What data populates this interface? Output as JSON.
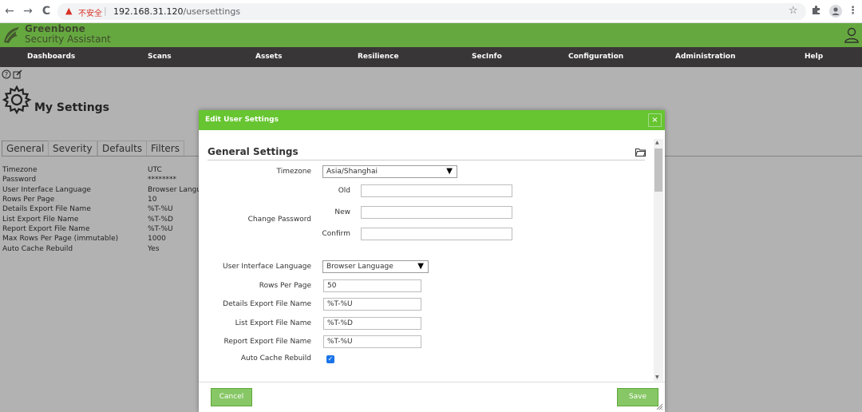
{
  "browser": {
    "back": "←",
    "forward": "→",
    "reload": "C",
    "insecure_label": "不安全",
    "url_host": "192.168.31.120",
    "url_path": "/usersettings"
  },
  "app": {
    "brand_line1": "Greenbone",
    "brand_line2": "Security Assistant"
  },
  "menu": {
    "items": [
      "Dashboards",
      "Scans",
      "Assets",
      "Resilience",
      "SecInfo",
      "Configuration",
      "Administration",
      "Help"
    ]
  },
  "page": {
    "title": "My Settings",
    "tabs": [
      "General",
      "Severity",
      "Defaults",
      "Filters"
    ],
    "settings": [
      {
        "label": "Timezone",
        "value": "UTC"
      },
      {
        "label": "Password",
        "value": "********"
      },
      {
        "label": "User Interface Language",
        "value": "Browser Langu"
      },
      {
        "label": "Rows Per Page",
        "value": "10"
      },
      {
        "label": "Details Export File Name",
        "value": "%T-%U"
      },
      {
        "label": "List Export File Name",
        "value": "%T-%D"
      },
      {
        "label": "Report Export File Name",
        "value": "%T-%U"
      },
      {
        "label": "Max Rows Per Page (immutable)",
        "value": "1000"
      },
      {
        "label": "Auto Cache Rebuild",
        "value": "Yes"
      }
    ]
  },
  "dialog": {
    "title": "Edit User Settings",
    "close": "×",
    "section_title": "General Settings",
    "timezone_label": "Timezone",
    "timezone_value": "Asia/Shanghai",
    "change_password_label": "Change Password",
    "old_label": "Old",
    "new_label": "New",
    "confirm_label": "Confirm",
    "ui_language_label": "User Interface Language",
    "ui_language_value": "Browser Language",
    "rows_per_page_label": "Rows Per Page",
    "rows_per_page_value": "50",
    "details_export_label": "Details Export File Name",
    "details_export_value": "%T-%U",
    "list_export_label": "List Export File Name",
    "list_export_value": "%T-%D",
    "report_export_label": "Report Export File Name",
    "report_export_value": "%T-%U",
    "auto_cache_label": "Auto Cache Rebuild",
    "auto_cache_checked": true,
    "cancel_label": "Cancel",
    "save_label": "Save"
  },
  "colors": {
    "header_green": "#66a840",
    "dialog_green": "#66c530",
    "menu_dark": "#393637",
    "button_green": "#87c766"
  }
}
